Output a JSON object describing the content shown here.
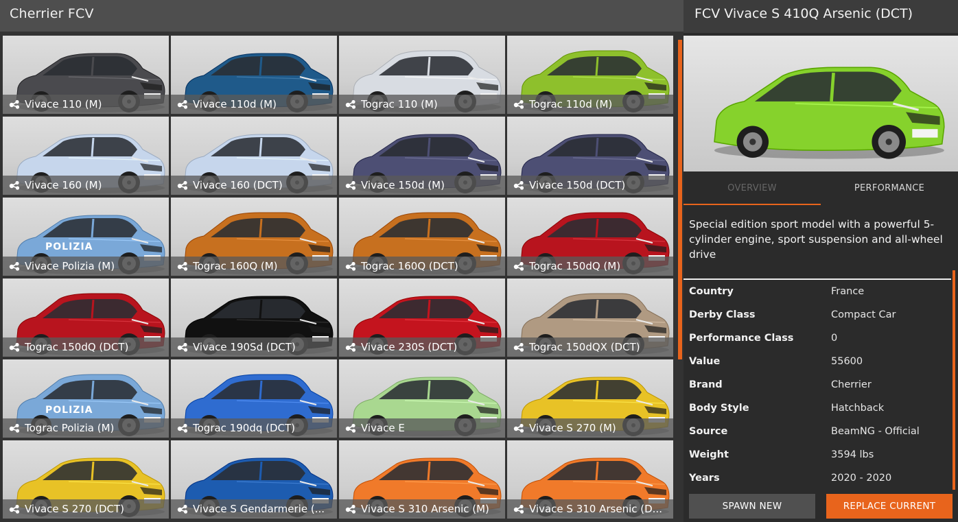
{
  "left_header": {
    "title": "Cherrier FCV"
  },
  "tiles": [
    {
      "label": "Vivace 110 (M)",
      "color": "#4a4a4e",
      "type": "hatch"
    },
    {
      "label": "Vivace 110d (M)",
      "color": "#1f5a8a",
      "type": "hatch"
    },
    {
      "label": "Tograc 110 (M)",
      "color": "#d8dce2",
      "type": "suv"
    },
    {
      "label": "Tograc 110d (M)",
      "color": "#8ec02c",
      "type": "suv"
    },
    {
      "label": "Vivace 160 (M)",
      "color": "#c6d6ec",
      "type": "hatch"
    },
    {
      "label": "Vivace 160 (DCT)",
      "color": "#c6d6ec",
      "type": "hatch"
    },
    {
      "label": "Vivace 150d (M)",
      "color": "#4d4f74",
      "type": "hatch"
    },
    {
      "label": "Vivace 150d (DCT)",
      "color": "#4d4f74",
      "type": "hatch"
    },
    {
      "label": "Vivace Polizia (M)",
      "color": "#7aa8d8",
      "type": "hatch",
      "livery": "POLIZIA"
    },
    {
      "label": "Tograc 160Q (M)",
      "color": "#c7701f",
      "type": "suv"
    },
    {
      "label": "Tograc 160Q (DCT)",
      "color": "#c7701f",
      "type": "suv"
    },
    {
      "label": "Tograc 150dQ (M)",
      "color": "#b8141e",
      "type": "suv"
    },
    {
      "label": "Tograc 150dQ (DCT)",
      "color": "#b8141e",
      "type": "suv"
    },
    {
      "label": "Vivace 190Sd (DCT)",
      "color": "#111111",
      "type": "hatch"
    },
    {
      "label": "Vivace 230S (DCT)",
      "color": "#c4141e",
      "type": "hatch"
    },
    {
      "label": "Tograc 150dQX (DCT)",
      "color": "#b09a82",
      "type": "suv"
    },
    {
      "label": "Tograc Polizia (M)",
      "color": "#7aa8d8",
      "type": "suv",
      "livery": "POLIZIA"
    },
    {
      "label": "Tograc 190dq (DCT)",
      "color": "#2f6cd0",
      "type": "suv"
    },
    {
      "label": "Vivace E",
      "color": "#a9d890",
      "type": "hatch"
    },
    {
      "label": "Vivace S 270 (M)",
      "color": "#e8c226",
      "type": "hatch"
    },
    {
      "label": "Vivace S 270 (DCT)",
      "color": "#e8c226",
      "type": "hatch"
    },
    {
      "label": "Vivace S Gendarmerie (...",
      "color": "#1d5cb0",
      "type": "hatch"
    },
    {
      "label": "Vivace S 310 Arsenic (M)",
      "color": "#f07a2a",
      "type": "hatch"
    },
    {
      "label": "Vivace S 310 Arsenic (D...",
      "color": "#f07a2a",
      "type": "hatch"
    }
  ],
  "detail": {
    "title": "FCV Vivace S 410Q Arsenic (DCT)",
    "preview_color": "#86d22c",
    "tab_overview": "OVERVIEW",
    "tab_performance": "PERFORMANCE",
    "description": "Special edition sport model with a powerful 5-cylinder engine, sport suspension and all-wheel drive",
    "stats": [
      {
        "key": "Country",
        "value": "France"
      },
      {
        "key": "Derby Class",
        "value": "Compact Car"
      },
      {
        "key": "Performance Class",
        "value": "0"
      },
      {
        "key": "Value",
        "value": "55600"
      },
      {
        "key": "Brand",
        "value": "Cherrier"
      },
      {
        "key": "Body Style",
        "value": "Hatchback"
      },
      {
        "key": "Source",
        "value": "BeamNG - Official"
      },
      {
        "key": "Weight",
        "value": "3594 lbs"
      },
      {
        "key": "Years",
        "value": "2020 - 2020"
      }
    ],
    "spawn_label": "SPAWN NEW",
    "replace_label": "REPLACE CURRENT"
  },
  "colors": {
    "accent": "#e8641c"
  },
  "icons": {
    "tile_config": "config-share-icon"
  }
}
